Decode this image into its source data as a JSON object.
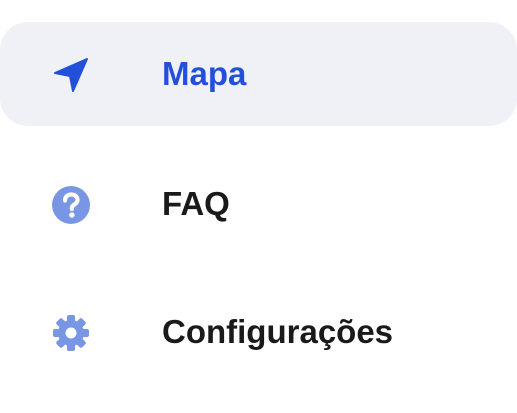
{
  "sidebar": {
    "items": [
      {
        "label": "Mapa",
        "icon": "location-arrow-icon",
        "active": true
      },
      {
        "label": "FAQ",
        "icon": "question-circle-icon",
        "active": false
      },
      {
        "label": "Configurações",
        "icon": "gear-icon",
        "active": false
      }
    ]
  },
  "colors": {
    "active_text": "#2250d8",
    "active_background": "#eff1f6",
    "inactive_text": "#1a1a1a",
    "icon_inactive": "#7896e3"
  }
}
